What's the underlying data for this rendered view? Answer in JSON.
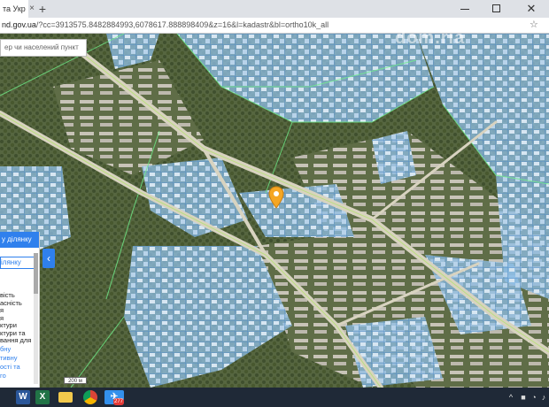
{
  "browser": {
    "tab_title": "та Укр",
    "url_host": "nd.gov.ua",
    "url_path": "/?cc=3913575.8482884993,6078617.888898409&z=16&l=kadastr&bl=ortho10k_all",
    "new_tab_icon": "plus-icon",
    "bookmark_icon": "star-icon"
  },
  "map": {
    "search_placeholder": "ер чи населений пункт",
    "watermark": "dom.ria",
    "marker_icon": "map-pin-icon",
    "marker_color": "#f5a623",
    "parcel_color": "#7fb8e6",
    "scale_label": "200 м"
  },
  "panel": {
    "header": "у ділянку",
    "button": "ілянку",
    "text_lines": [
      "вість",
      "асність",
      "я",
      "я",
      "ктури",
      "ктури та",
      "вання для"
    ],
    "link_lines": [
      "бну",
      "тивну",
      "ості та",
      "го"
    ],
    "accent_color": "#2f80ed",
    "collapse_icon": "chevron-left-icon"
  },
  "taskbar": {
    "apps": [
      {
        "name": "word",
        "label": "W",
        "color": "#2b579a"
      },
      {
        "name": "excel",
        "label": "X",
        "color": "#217346"
      },
      {
        "name": "explorer",
        "label": "",
        "color": "#f2c94c"
      },
      {
        "name": "chrome",
        "label": "",
        "color": "#db4437"
      },
      {
        "name": "telegram",
        "label": "",
        "color": "#3390ec"
      }
    ],
    "telegram_badge": "277",
    "tray": [
      "^",
      "■",
      "◔",
      "♪"
    ]
  }
}
